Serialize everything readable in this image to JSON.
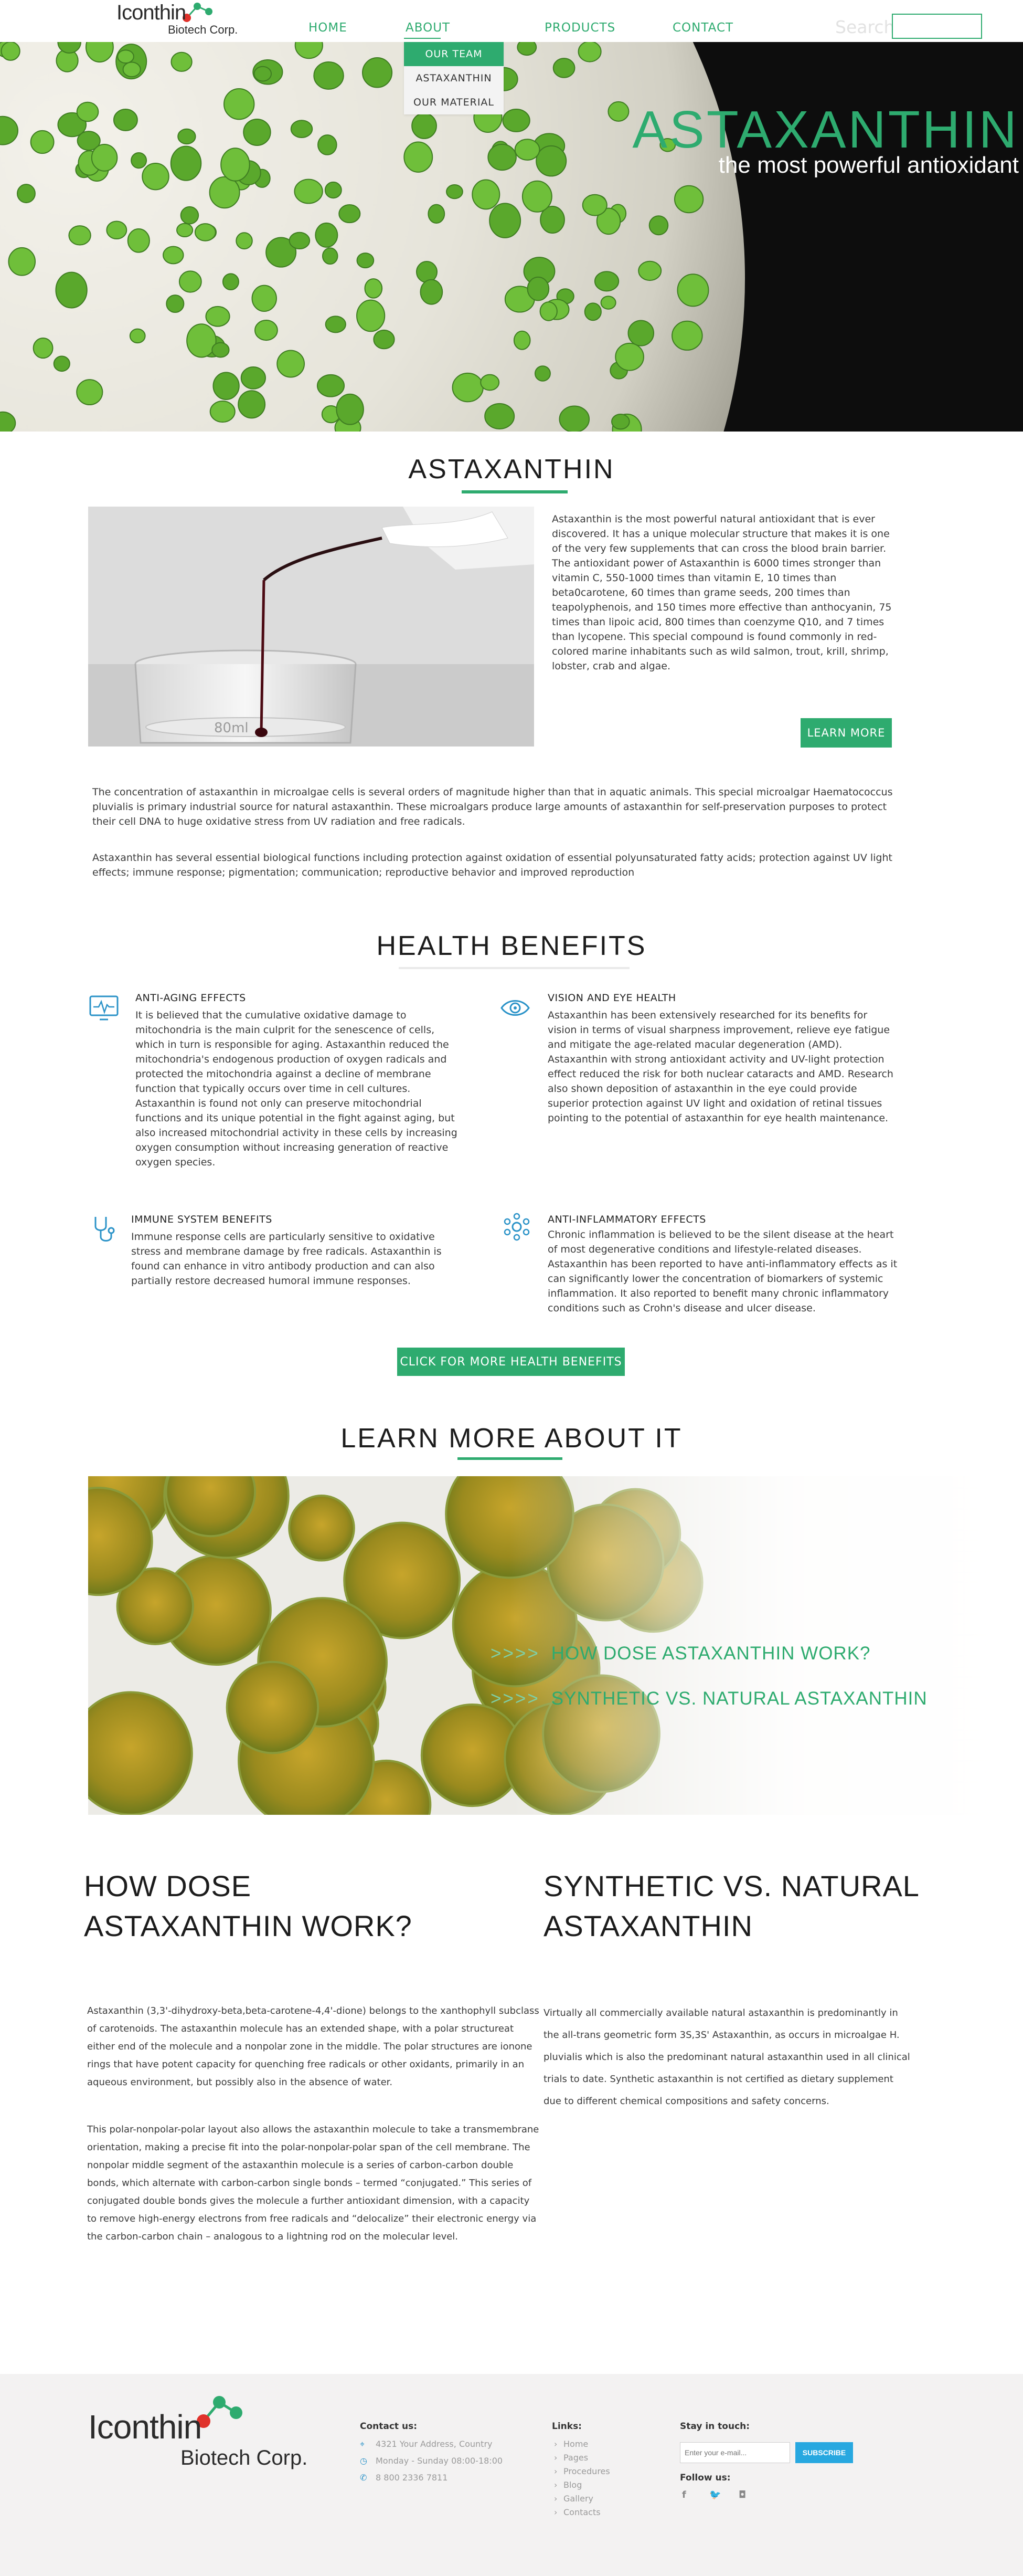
{
  "brand": {
    "name": "Iconthin",
    "sub": "Biotech Corp.",
    "colors": {
      "accent": "#2eab6f",
      "subscribe": "#27a8e0",
      "dot_green": "#2eab6f",
      "dot_red": "#e0322b"
    }
  },
  "nav": {
    "items": [
      {
        "label": "HOME"
      },
      {
        "label": "ABOUT"
      },
      {
        "label": "PRODUCTS"
      },
      {
        "label": "CONTACT"
      }
    ],
    "search_label": "Search",
    "search_placeholder": "",
    "about_menu": [
      {
        "label": "OUR TEAM",
        "active": true
      },
      {
        "label": "ASTAXANTHIN",
        "active": false
      },
      {
        "label": "OUR MATERIAL",
        "active": false
      }
    ]
  },
  "hero": {
    "title": "ASTAXANTHIN",
    "subtitle": "the most powerful antioxidant"
  },
  "astaxanthin": {
    "title": "ASTAXANTHIN",
    "intro": "Astaxanthin is the most powerful natural antioxidant that is ever discovered. It has a unique molecular structure that makes it is one of the very few supplements that can cross the blood brain barrier. The antioxidant power of Astaxanthin is 6000 times stronger than vitamin C, 550-1000 times than vitamin E, 10 times than beta0carotene, 60 times than grame seeds, 200 times than teapolyphenois, and 150 times more effective than anthocyanin, 75 times than lipoic acid, 800 times than coenzyme Q10, and 7 times than lycopene. This special compound is found commonly in red-colored marine inhabitants such as wild salmon, trout, krill, shrimp, lobster, crab and algae.",
    "learn_more": "LEARN MORE",
    "para1": "The concentration of astaxanthin in microalgae cells is several orders of magnitude higher than that in aquatic animals. This special microalgar Haematococcus pluvialis is primary industrial source for natural astaxanthin. These microalgars produce large amounts of astaxanthin for self-preservation purposes to protect their cell DNA to huge oxidative stress from UV radiation and free radicals.",
    "para2": "Astaxanthin has several essential biological functions including protection against oxidation of essential polyunsaturated fatty acids; protection against UV light effects; immune response; pigmentation; communication; reproductive behavior and improved reproduction"
  },
  "health": {
    "title": "HEALTH BENEFITS",
    "items": [
      {
        "icon": "monitor-pulse-icon",
        "heading": "ANTI-AGING EFFECTS",
        "text": "It is believed that the cumulative oxidative damage to mitochondria is the main culprit for the senescence of cells, which in turn is responsible for aging. Astaxanthin reduced the mitochondria's endogenous production of oxygen radicals and protected the mitochondria against a decline of membrane function that typically occurs over time in cell cultures. Astaxanthin is found not only can preserve mitochondrial functions and its unique potential in the fight against aging, but also increased mitochondrial activity in these cells by increasing oxygen consumption without increasing generation of reactive oxygen species."
      },
      {
        "icon": "eye-icon",
        "heading": "VISION AND EYE HEALTH",
        "text": "Astaxanthin has been extensively researched for its benefits for vision in terms of visual sharpness improvement, relieve eye fatigue and mitigate the age-related macular degeneration (AMD). Astaxanthin with strong antioxidant activity and UV-light protection effect reduced the risk for both nuclear cataracts and AMD. Research also shown deposition of astaxanthin in the eye could provide superior protection against UV light and oxidation of retinal tissues pointing to the potential of astaxanthin for eye health maintenance."
      },
      {
        "icon": "stethoscope-icon",
        "heading": "IMMUNE SYSTEM BENEFITS",
        "text": "Immune response cells are particularly sensitive to oxidative stress and membrane damage by free radicals. Astaxanthin is found can enhance in vitro antibody production and can also partially restore decreased humoral immune responses."
      },
      {
        "icon": "virus-icon",
        "heading": "ANTI-INFLAMMATORY EFFECTS",
        "text": "Chronic inflammation is believed to be the silent disease at the heart of most degenerative conditions and lifestyle-related diseases. Astaxanthin has been reported to have anti-inflammatory effects as it can significantly lower the concentration of biomarkers of systemic inflammation. It also reported to benefit many chronic inflammatory conditions such as Crohn's disease and ulcer disease."
      }
    ],
    "cta": "CLICK FOR  MORE HEALTH BENEFITS"
  },
  "learn": {
    "title": "LEARN MORE ABOUT IT",
    "links": [
      {
        "arrows": ">>>>",
        "label": "HOW DOSE ASTAXANTHIN WORK?"
      },
      {
        "arrows": ">>>>",
        "label": "SYNTHETIC VS. NATURAL ASTAXANTHIN"
      }
    ]
  },
  "how": {
    "title_line1": "HOW DOSE",
    "title_line2": "ASTAXANTHIN WORK?",
    "para1": "Astaxanthin (3,3'-dihydroxy-beta,beta-carotene-4,4'-dione) belongs to the xanthophyll subclass of carotenoids. The astaxanthin molecule has an extended shape, with a polar structureat either end of the molecule and a nonpolar zone in the middle. The polar structures are ionone rings that have potent capacity for quenching free radicals or other oxidants, primarily in an aqueous environment, but possibly also in the absence of water.",
    "para2": "This polar-nonpolar-polar layout also allows the astaxanthin molecule to take a transmembrane orientation, making a precise fit into the polar-nonpolar-polar span of the cell membrane. The nonpolar middle segment of the astaxanthin molecule is a series of carbon-carbon double bonds, which alternate with carbon-carbon single bonds – termed “conjugated.” This series of conjugated double bonds gives the molecule a further antioxidant dimension, with a capacity to remove high-energy electrons from free radicals and “delocalize” their electronic energy via the carbon-carbon chain – analogous to a lightning rod on the molecular level."
  },
  "synthetic": {
    "title_line1": "SYNTHETIC VS. NATURAL",
    "title_line2": "ASTAXANTHIN",
    "para": "Virtually all commercially available natural astaxanthin is predominantly in the all-trans geometric form 3S,3S' Astaxanthin, as occurs in microalgae H. pluvialis which is also the predominant natural astaxanthin used in all clinical trials to date. Synthetic astaxanthin is not certified as dietary supplement due to different chemical compositions and safety concerns."
  },
  "footer": {
    "contact_head": "Contact us:",
    "address": "4321 Your Address, Country",
    "hours": "Monday - Sunday 08:00-18:00",
    "phone": "8 800 2336 7811",
    "links_head": "Links:",
    "links": [
      "Home",
      "Pages",
      "Procedures",
      "Blog",
      "Gallery",
      "Contacts"
    ],
    "stay_head": "Stay in touch:",
    "email_placeholder": "Enter your e-mail...",
    "subscribe": "SUBSCRIBE",
    "follow_head": "Follow us:",
    "social": [
      "facebook-icon",
      "twitter-icon",
      "instagram-icon"
    ]
  }
}
